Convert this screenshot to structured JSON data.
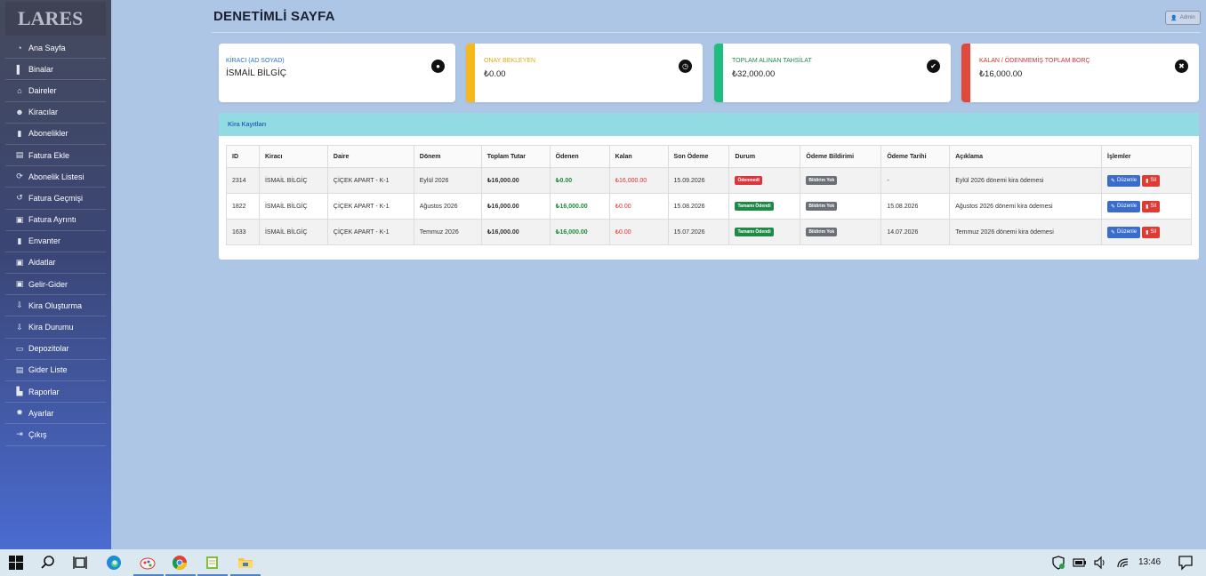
{
  "sidebar": {
    "logo": "LARES",
    "items": [
      {
        "label": "Ana Sayfa",
        "icon": "dashboard-icon",
        "glyph": "◔"
      },
      {
        "label": "Binalar",
        "icon": "building-icon",
        "glyph": "▌"
      },
      {
        "label": "Daireler",
        "icon": "home-icon",
        "glyph": "⌂"
      },
      {
        "label": "Kiracılar",
        "icon": "users-icon",
        "glyph": "☻"
      },
      {
        "label": "Abonelikler",
        "icon": "clipboard-icon",
        "glyph": "▮"
      },
      {
        "label": "Fatura Ekle",
        "icon": "invoice-icon",
        "glyph": "▤"
      },
      {
        "label": "Abonelik Listesi",
        "icon": "sync-icon",
        "glyph": "⟳"
      },
      {
        "label": "Fatura Geçmişi",
        "icon": "history-icon",
        "glyph": "↺"
      },
      {
        "label": "Fatura Ayrıntı",
        "icon": "money-icon",
        "glyph": "▣"
      },
      {
        "label": "Envanter",
        "icon": "inventory-icon",
        "glyph": "▮"
      },
      {
        "label": "Aidatlar",
        "icon": "cash-icon",
        "glyph": "▣"
      },
      {
        "label": "Gelir-Gider",
        "icon": "wallet-icon",
        "glyph": "▣"
      },
      {
        "label": "Kira Oluşturma",
        "icon": "hand-coin-icon",
        "glyph": "⇩"
      },
      {
        "label": "Kira Durumu",
        "icon": "hand-coin-icon",
        "glyph": "⇩"
      },
      {
        "label": "Depozitolar",
        "icon": "card-icon",
        "glyph": "▭"
      },
      {
        "label": "Gider Liste",
        "icon": "list-icon",
        "glyph": "▤"
      },
      {
        "label": "Raporlar",
        "icon": "chart-icon",
        "glyph": "▙"
      },
      {
        "label": "Ayarlar",
        "icon": "gear-icon",
        "glyph": "✹"
      },
      {
        "label": "Çıkış",
        "icon": "logout-icon",
        "glyph": "⇥"
      }
    ]
  },
  "header": {
    "title": "DENETİMLİ SAYFA",
    "admin_label": "Admin"
  },
  "cards": [
    {
      "label": "KİRACI (AD SOYAD)",
      "value": "İSMAİL BİLGİÇ",
      "color": "#ffffff",
      "label_color": "#2a6fd1",
      "icon": "user-circle-icon",
      "glyph": "●"
    },
    {
      "label": "ONAY BEKLEYEN",
      "value": "₺0.00",
      "color": "#f5b81d",
      "label_color": "#e6a518",
      "icon": "clock-icon",
      "glyph": "◷"
    },
    {
      "label": "TOPLAM ALINAN TAHSİLAT",
      "value": "₺32,000.00",
      "color": "#1fbe7e",
      "label_color": "#1e8a53",
      "icon": "check-circle-icon",
      "glyph": "✔"
    },
    {
      "label": "KALAN / ÖDENMEMİŞ TOPLAM BORÇ",
      "value": "₺16,000.00",
      "color": "#e0483b",
      "label_color": "#d43131",
      "icon": "close-circle-icon",
      "glyph": "✖"
    }
  ],
  "panel": {
    "title": "Kira Kayıtları",
    "columns": [
      "ID",
      "Kiracı",
      "Daire",
      "Dönem",
      "Toplam Tutar",
      "Ödenen",
      "Kalan",
      "Son Ödeme",
      "Durum",
      "Ödeme Bildirimi",
      "Ödeme Tarihi",
      "Açıklama",
      "İşlemler"
    ],
    "rows": [
      {
        "id": "2314",
        "tenant": "İSMAİL BİLGİÇ",
        "flat": "ÇİÇEK APART - K-1",
        "period": "Eylül 2026",
        "total": "₺16,000.00",
        "paid": "₺0.00",
        "remaining": "₺16,000.00",
        "last_payment": "15.09.2026",
        "status": "Ödenmedi",
        "notice": "Bildirim Yok",
        "payment_date": "-",
        "desc": "Eylül 2026 dönemi kira ödemesi"
      },
      {
        "id": "1822",
        "tenant": "İSMAİL BİLGİÇ",
        "flat": "ÇİÇEK APART - K-1",
        "period": "Ağustos 2026",
        "total": "₺16,000.00",
        "paid": "₺16,000.00",
        "remaining": "₺0.00",
        "last_payment": "15.08.2026",
        "status": "Tamamı Ödendi",
        "notice": "Bildirim Yok",
        "payment_date": "15.08.2026",
        "desc": "Ağustos 2026 dönemi kira ödemesi"
      },
      {
        "id": "1633",
        "tenant": "İSMAİL BİLGİÇ",
        "flat": "ÇİÇEK APART - K-1",
        "period": "Temmuz 2026",
        "total": "₺16,000.00",
        "paid": "₺16,000.00",
        "remaining": "₺0.00",
        "last_payment": "15.07.2026",
        "status": "Tamamı Ödendi",
        "notice": "Bildirim Yok",
        "payment_date": "14.07.2026",
        "desc": "Temmuz 2026 dönemi kira ödemesi"
      }
    ],
    "edit_label": "Düzenle",
    "delete_label": "Sil"
  },
  "taskbar": {
    "time": "13:46",
    "apps": [
      "windows-start-icon",
      "search-icon",
      "task-view-icon",
      "edge-icon",
      "paint-icon",
      "chrome-icon",
      "notepad-icon",
      "file-explorer-icon"
    ]
  }
}
